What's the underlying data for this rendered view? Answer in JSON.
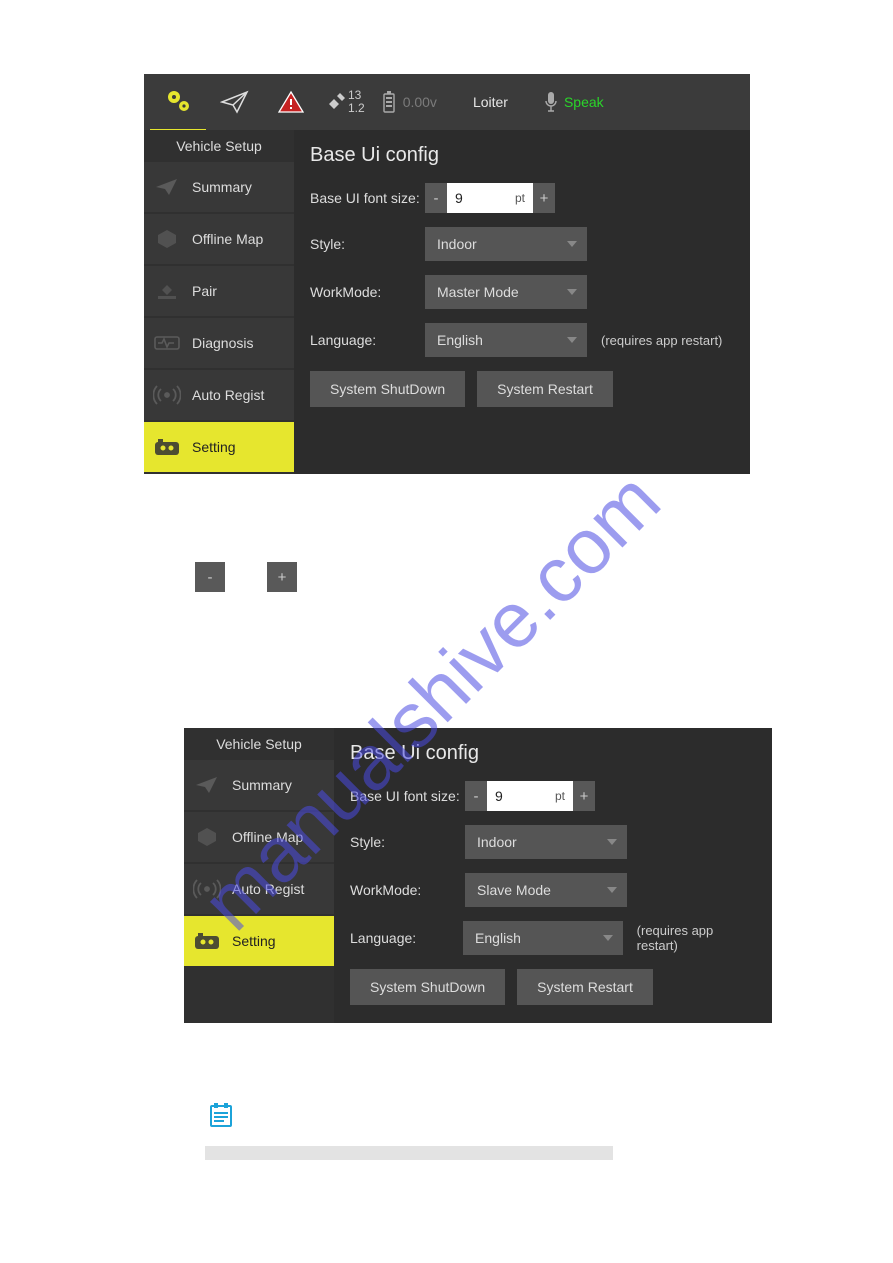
{
  "topbar": {
    "sat_top": "13",
    "sat_bottom": "1.2",
    "voltage": "0.00v",
    "flight_mode": "Loiter",
    "speak_label": "Speak"
  },
  "sidebar_title": "Vehicle Setup",
  "sidebar1": [
    {
      "label": "Summary"
    },
    {
      "label": "Offline Map"
    },
    {
      "label": "Pair"
    },
    {
      "label": "Diagnosis"
    },
    {
      "label": "Auto Regist"
    },
    {
      "label": "Setting"
    }
  ],
  "sidebar2": [
    {
      "label": "Summary"
    },
    {
      "label": "Offline Map"
    },
    {
      "label": "Auto Regist"
    },
    {
      "label": "Setting"
    }
  ],
  "config": {
    "heading": "Base Ui config",
    "font_label": "Base UI font size:",
    "font_value": "9",
    "font_unit": "pt",
    "minus": "-",
    "plus": "+",
    "style_label": "Style:",
    "workmode_label": "WorkMode:",
    "language_label": "Language:",
    "language_note": "(requires app restart)",
    "shutdown": "System ShutDown",
    "restart": "System Restart"
  },
  "values1": {
    "style": "Indoor",
    "workmode": "Master Mode",
    "language": "English"
  },
  "values2": {
    "style": "Indoor",
    "workmode": "Slave Mode",
    "language": "English"
  },
  "watermark": "manualshive.com"
}
